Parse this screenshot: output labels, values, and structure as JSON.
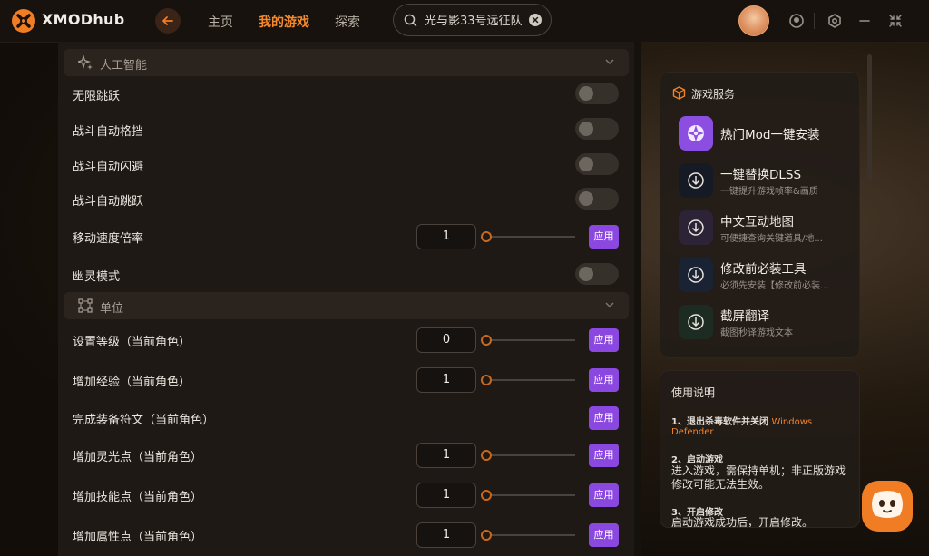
{
  "app": {
    "name": "XMODhub"
  },
  "nav": {
    "home": "主页",
    "my_games": "我的游戏",
    "explore": "探索"
  },
  "search": {
    "value": "光与影33号远征队"
  },
  "colors": {
    "accent": "#f58a2c",
    "apply": "#8a48e0"
  },
  "sections": {
    "ai": {
      "title": "人工智能",
      "icon": "sparkle-icon"
    },
    "unit": {
      "title": "单位",
      "icon": "network-icon"
    }
  },
  "rows": {
    "infinite_jump": {
      "label": "无限跳跃",
      "enabled": false
    },
    "auto_parry": {
      "label": "战斗自动格挡",
      "enabled": false
    },
    "auto_dodge": {
      "label": "战斗自动闪避",
      "enabled": false
    },
    "auto_jump": {
      "label": "战斗自动跳跃",
      "enabled": false
    },
    "move_speed": {
      "label": "移动速度倍率",
      "value": "1"
    },
    "ghost_mode": {
      "label": "幽灵模式",
      "enabled": false
    },
    "set_level": {
      "label": "设置等级（当前角色）",
      "value": "0"
    },
    "add_exp": {
      "label": "增加经验（当前角色）",
      "value": "1"
    },
    "complete_rune": {
      "label": "完成装备符文（当前角色）"
    },
    "add_lumina": {
      "label": "增加灵光点（当前角色）",
      "value": "1"
    },
    "add_skill": {
      "label": "增加技能点（当前角色）",
      "value": "1"
    },
    "add_attr": {
      "label": "增加属性点（当前角色）",
      "value": "1"
    }
  },
  "apply_label": "应用",
  "services": {
    "title": "游戏服务",
    "items": [
      {
        "name": "热门Mod一键安装",
        "sub": ""
      },
      {
        "name": "一键替换DLSS",
        "sub": "一键提升游戏帧率&画质"
      },
      {
        "name": "中文互动地图",
        "sub": "可便捷查询关键道具/地..."
      },
      {
        "name": "修改前必装工具",
        "sub": "必须先安装【修改前必装..."
      },
      {
        "name": "截屏翻译",
        "sub": "截图秒译游戏文本"
      }
    ]
  },
  "guide": {
    "title": "使用说明",
    "step1_title": "1、退出杀毒软件并关闭",
    "step1_highlight": "Windows Defender",
    "step2_title": "2、启动游戏",
    "step2_body": "进入游戏，需保持单机；非正版游戏修改可能无法生效。",
    "step3_title": "3、开启修改",
    "step3_body": "启动游戏成功后，开启修改。"
  }
}
